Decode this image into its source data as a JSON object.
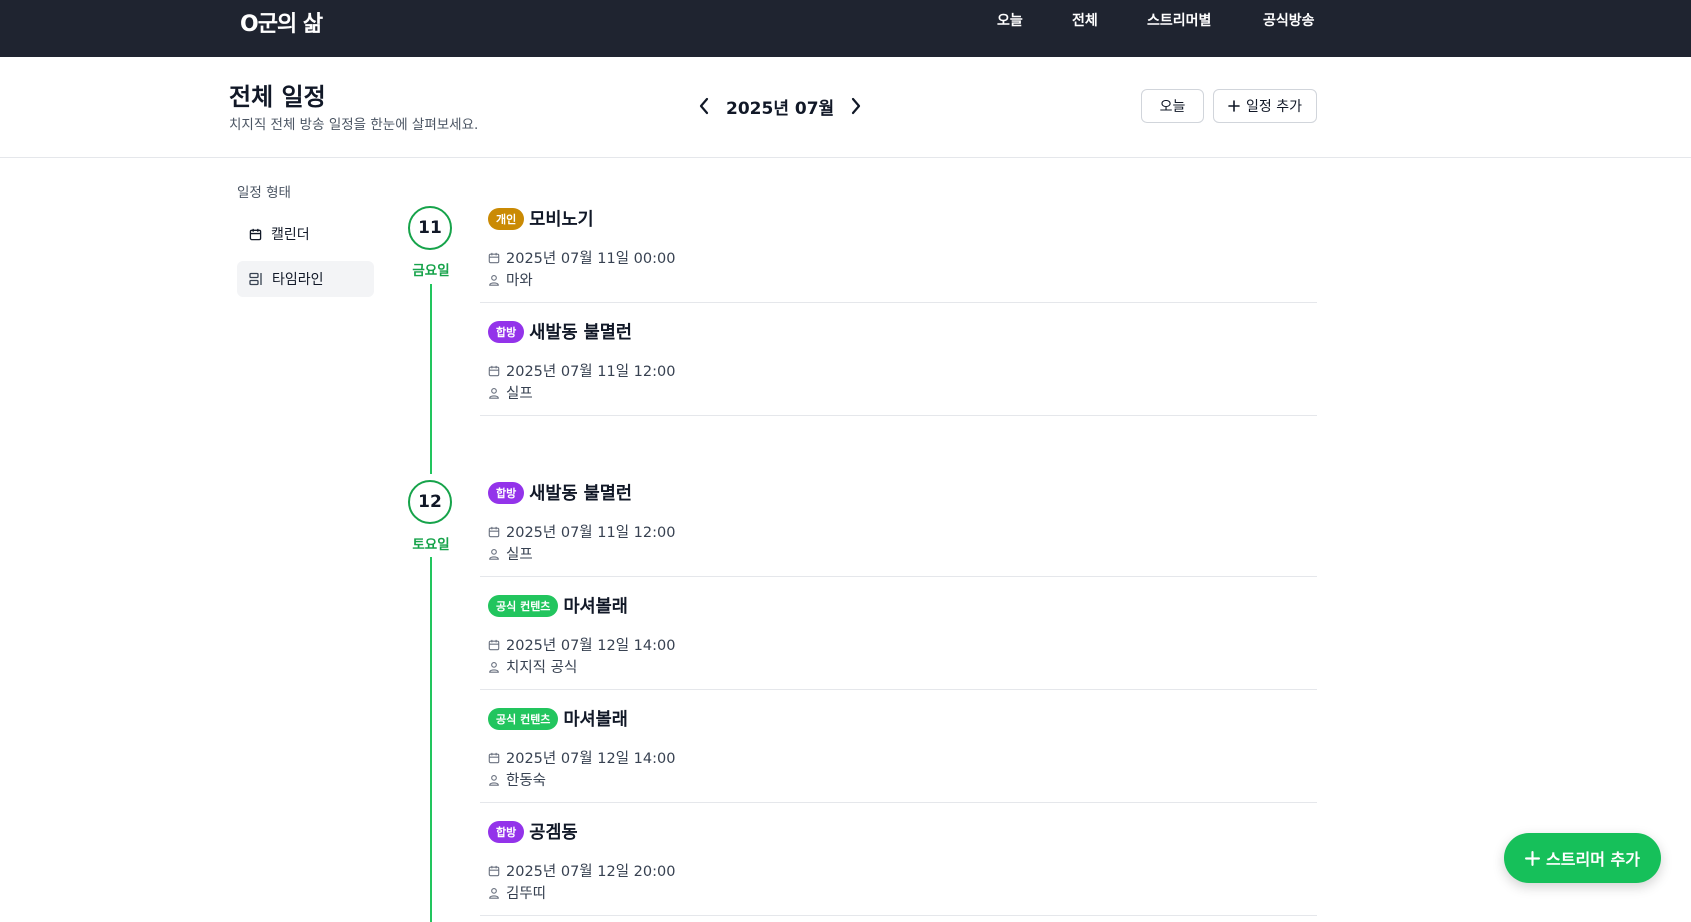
{
  "brand": "O군의 삶",
  "nav": [
    "오늘",
    "전체",
    "스트리머별",
    "공식방송"
  ],
  "header": {
    "title": "전체 일정",
    "subtitle": "치지직 전체 방송 일정을 한눈에 살펴보세요.",
    "month": "2025년 07월",
    "today_button": "오늘",
    "add_button": "일정 추가"
  },
  "sidebar": {
    "heading": "일정 형태",
    "items": [
      {
        "label": "캘린더",
        "icon": "calendar-icon",
        "active": false
      },
      {
        "label": "타임라인",
        "icon": "timeline-icon",
        "active": true
      }
    ]
  },
  "days": [
    {
      "day": "11",
      "weekday": "금요일",
      "events": [
        {
          "badge": "개인",
          "badge_color": "#ca8a04",
          "title": "모비노기",
          "datetime": "2025년 07월 11일 00:00",
          "streamer": "마와"
        },
        {
          "badge": "합방",
          "badge_color": "#9333ea",
          "title": "새발동 불멸런",
          "datetime": "2025년 07월 11일 12:00",
          "streamer": "실프"
        }
      ]
    },
    {
      "day": "12",
      "weekday": "토요일",
      "events": [
        {
          "badge": "합방",
          "badge_color": "#9333ea",
          "title": "새발동 불멸런",
          "datetime": "2025년 07월 11일 12:00",
          "streamer": "실프"
        },
        {
          "badge": "공식 컨텐츠",
          "badge_color": "#22c55e",
          "title": "마셔볼래",
          "datetime": "2025년 07월 12일 14:00",
          "streamer": "치지직 공식"
        },
        {
          "badge": "공식 컨텐츠",
          "badge_color": "#22c55e",
          "title": "마셔볼래",
          "datetime": "2025년 07월 12일 14:00",
          "streamer": "한동숙"
        },
        {
          "badge": "합방",
          "badge_color": "#9333ea",
          "title": "공겜동",
          "datetime": "2025년 07월 12일 20:00",
          "streamer": "김뚜띠"
        }
      ]
    }
  ],
  "fab": {
    "label": "스트리머 추가"
  },
  "colors": {
    "topbar": "#1f2430",
    "accent": "#16a34a",
    "fab": "#16c05a"
  }
}
